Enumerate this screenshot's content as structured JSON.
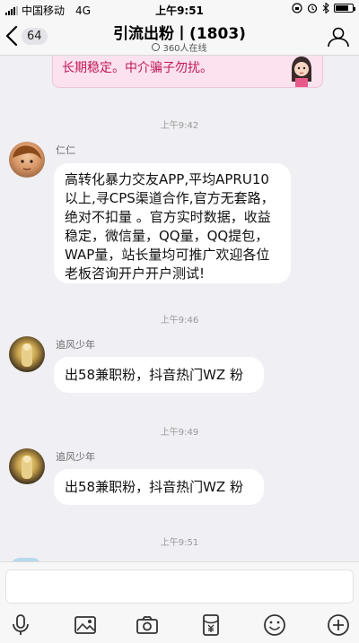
{
  "status_bar": {
    "carrier": "中国移动",
    "network": "4G",
    "time": "上午9:51",
    "battery_level": 0.8
  },
  "nav": {
    "back_count": "64",
    "title": "引流出粉丨(1803)",
    "online": "360人在线",
    "back_icon": "chevron-left-icon",
    "profile_icon": "group-members-icon"
  },
  "banner": {
    "text": "长期稳定。中介骗子勿扰。"
  },
  "messages": [
    {
      "time": "上午9:42",
      "sender": "仁仁",
      "text": "高转化暴力交友APP,平均APRU10以上,寻CPS渠道合作,官方无套路，绝对不扣量 。官方实时数据，收益稳定，微信量，QQ量，QQ提包，WAP量，站长量均可推广欢迎各位老板咨询开户开户测试!"
    },
    {
      "time": "上午9:46",
      "sender": "追风少年",
      "text": "出58兼职粉，抖音热门WZ 粉"
    },
    {
      "time": "上午9:49",
      "sender": "追风少年",
      "text": "出58兼职粉，抖音热门WZ 粉"
    },
    {
      "time": "上午9:51"
    }
  ],
  "toolbar": {
    "icons": [
      "microphone-icon",
      "image-icon",
      "camera-icon",
      "red-packet-icon",
      "emoji-icon",
      "plus-icon"
    ]
  },
  "colors": {
    "background": "#efeff4",
    "banner_bg": "#fbe2ee",
    "banner_text": "#c2185b",
    "bubble": "#ffffff"
  }
}
